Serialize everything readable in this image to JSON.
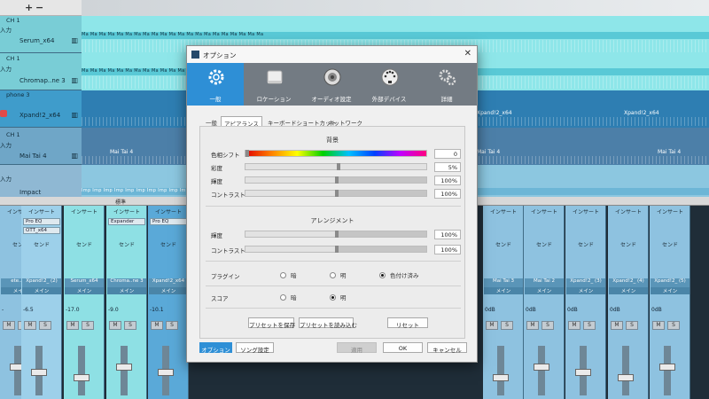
{
  "toolbar": {
    "plus": "+",
    "minus": "−"
  },
  "tracks": [
    {
      "name": "Serum_x64",
      "channel": "CH 1",
      "input": "入力",
      "kb": "▥"
    },
    {
      "name": "Chromap..ne 3",
      "channel": "CH 1",
      "input": "入力",
      "kb": "▥"
    },
    {
      "name": "Xpand!2_x64",
      "channel": "phone 3",
      "input": "",
      "kb": "▥"
    },
    {
      "name": "Mai Tai 4",
      "channel": "CH 1",
      "input": "入力",
      "kb": "▥"
    },
    {
      "name": "Impact",
      "channel": "",
      "input": "入力",
      "kb": ""
    }
  ],
  "clips": {
    "serum": "Ma Ma Ma Ma Ma Ma Ma Ma Ma Ma Ma Ma Ma Ma Ma Ma Ma Ma Ma Ma Ma",
    "xpand_a": "Xpand!2_x64",
    "xpand_b": "Xpand!2_x64",
    "maitai": "Mai Tai 4",
    "imp": "Imp Imp Imp Imp Imp Imp Imp Imp Imp Imp Imp Imp"
  },
  "mixer": {
    "header": "標準",
    "insert_label": "インサート",
    "send_label": "センド",
    "main_label": "メイン",
    "strips": [
      {
        "name": "ete..troi",
        "sub": "メイン",
        "val": "-",
        "slots": []
      },
      {
        "name": "Xpand!2_ (2)",
        "sub": "メイン",
        "val": "-6.5",
        "slots": [
          "Pro EQ",
          "OTT_x64"
        ]
      },
      {
        "name": "Serum_x64",
        "sub": "メイン",
        "val": "-17.0",
        "slots": []
      },
      {
        "name": "Chroma..ne 3",
        "sub": "メイン",
        "val": "-9.0",
        "slots": [
          "Expander"
        ]
      },
      {
        "name": "Xpand!2_x64",
        "sub": "メイン",
        "val": "-10.1",
        "slots": [
          "Pro EQ"
        ]
      },
      {
        "name": "Mai Tai 3",
        "sub": "メイン",
        "val": "0dB",
        "slots": []
      },
      {
        "name": "Mai Tai 2",
        "sub": "メイン",
        "val": "0dB",
        "slots": []
      },
      {
        "name": "Xpand!2_ (3)",
        "sub": "メイン",
        "val": "0dB",
        "slots": []
      },
      {
        "name": "Xpand!2_ (4)",
        "sub": "メイン",
        "val": "0dB",
        "slots": []
      },
      {
        "name": "Xpand!2_ (5)",
        "sub": "メイン",
        "val": "0dB",
        "slots": []
      }
    ]
  },
  "dialog": {
    "title": "オプション",
    "close": "✕",
    "categories": [
      {
        "label": "一般",
        "icon": "gear-icon"
      },
      {
        "label": "ロケーション",
        "icon": "folder-icon"
      },
      {
        "label": "オーディオ設定",
        "icon": "speaker-icon"
      },
      {
        "label": "外部デバイス",
        "icon": "midi-connector-icon"
      },
      {
        "label": "詳細",
        "icon": "gears-icon"
      }
    ],
    "tabs": [
      "一般",
      "アピアランス",
      "キーボードショートカット",
      "ネットワーク"
    ],
    "background": {
      "header": "背景",
      "hue_label": "色相シフト",
      "hue_value": "0",
      "sat_label": "彩度",
      "sat_value": "5%",
      "sat_level": 0.05,
      "lum_label": "輝度",
      "lum_value": "100%",
      "lum_level": 1.0,
      "contrast_label": "コントラスト",
      "contrast_value": "100%",
      "contrast_level": 1.0
    },
    "arrange": {
      "header": "アレンジメント",
      "lum_label": "輝度",
      "lum_value": "100%",
      "lum_level": 1.0,
      "contrast_label": "コントラスト",
      "contrast_value": "100%",
      "contrast_level": 1.0
    },
    "plugin": {
      "label": "プラグイン",
      "dark": "暗",
      "light": "明",
      "colored": "色付け済み",
      "selected": "colored"
    },
    "score": {
      "label": "スコア",
      "dark": "暗",
      "light": "明",
      "selected": "light"
    },
    "buttons": {
      "save_preset": "プリセットを保存",
      "load_preset": "プリセットを読み込む",
      "reset": "リセット",
      "options": "オプション",
      "song_settings": "ソング設定",
      "apply": "適用",
      "ok": "OK",
      "cancel": "キャンセル"
    }
  }
}
